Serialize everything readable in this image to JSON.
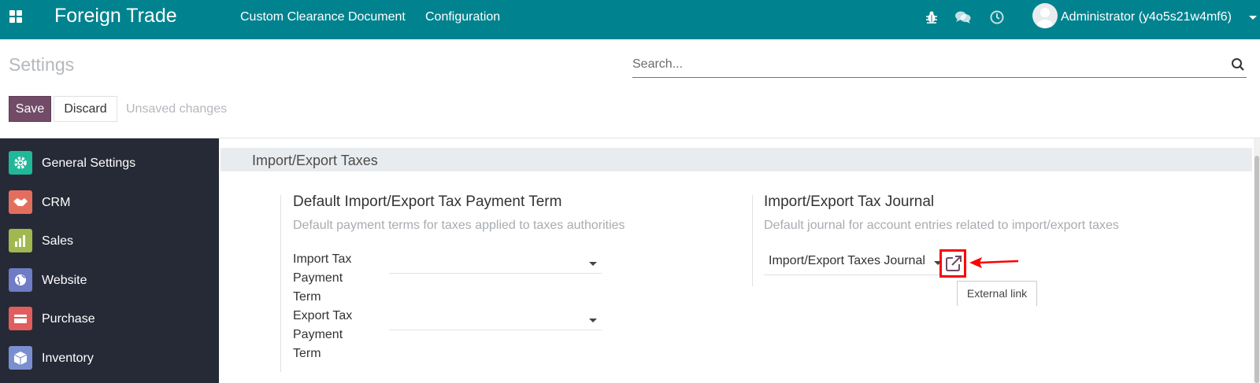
{
  "navbar": {
    "brand": "Foreign Trade",
    "menu": [
      "Custom Clearance Document",
      "Configuration"
    ],
    "user": "Administrator (y4o5s21w4mf6)",
    "icons": [
      "apps-icon",
      "bug-icon",
      "chat-icon",
      "clock-icon"
    ]
  },
  "control_panel": {
    "title": "Settings",
    "search_placeholder": "Search...",
    "save_label": "Save",
    "discard_label": "Discard",
    "status": "Unsaved changes"
  },
  "sidebar": {
    "items": [
      {
        "label": "General Settings",
        "color": "#21b799"
      },
      {
        "label": "CRM",
        "color": "#e46e5d"
      },
      {
        "label": "Sales",
        "color": "#9fb94f"
      },
      {
        "label": "Website",
        "color": "#6f7cc6"
      },
      {
        "label": "Purchase",
        "color": "#e25d5d"
      },
      {
        "label": "Inventory",
        "color": "#7a8fcf"
      }
    ]
  },
  "main": {
    "section_title": "Import/Export Taxes",
    "payment_term": {
      "title": "Default Import/Export Tax Payment Term",
      "description": "Default payment terms for taxes applied to taxes authorities",
      "import_label_lines": [
        "Import Tax",
        "Payment",
        "Term"
      ],
      "export_label_lines": [
        "Export Tax",
        "Payment",
        "Term"
      ]
    },
    "journal": {
      "title": "Import/Export Tax Journal",
      "description": "Default journal for account entries related to import/export taxes",
      "value": "Import/Export Taxes Journal",
      "tooltip": "External link"
    }
  },
  "colors": {
    "navbar": "#00838f",
    "primary": "#714b67",
    "highlight": "#ff0000"
  }
}
